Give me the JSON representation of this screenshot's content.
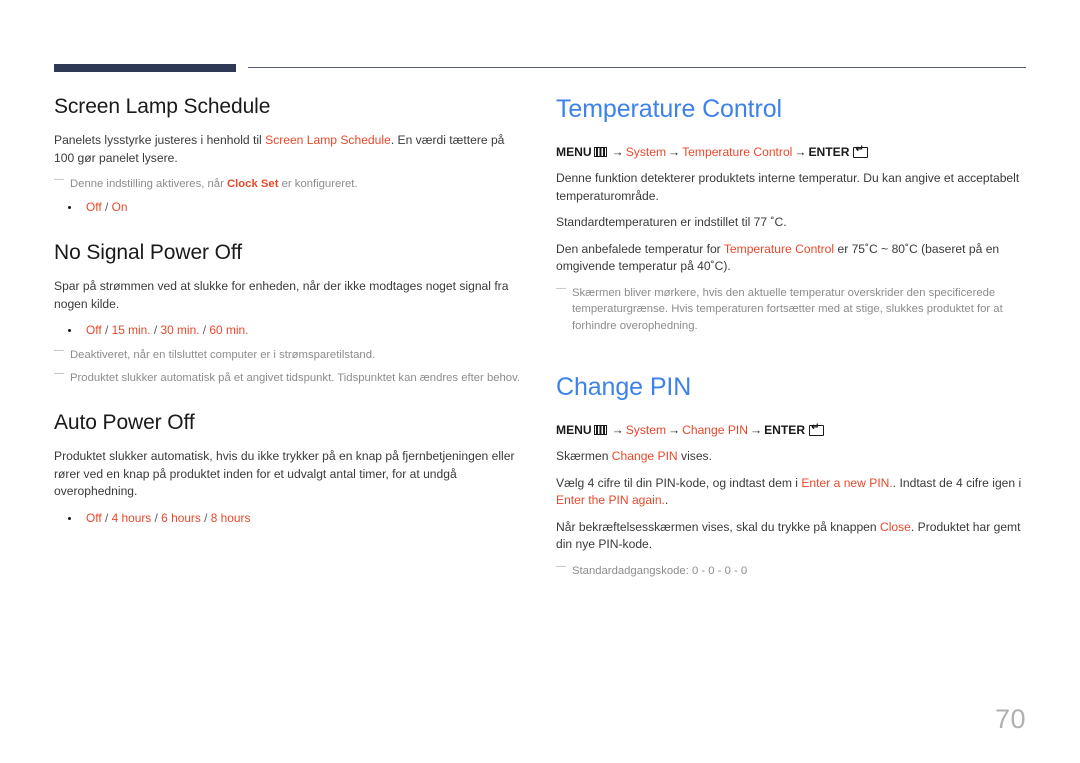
{
  "document": {
    "page_number": "70",
    "accent_color": "#e8482b",
    "heading_blue": "#3d82ea",
    "rule_color": "#2e3a55"
  },
  "left_column": {
    "sections": [
      {
        "title": "Screen Lamp Schedule",
        "paragraph_pre": "Panelets lysstyrke justeres i henhold til ",
        "paragraph_accent": "Screen Lamp Schedule",
        "paragraph_post": ". En værdi tættere på 100 gør panelet lysere.",
        "note_pre": "Denne indstilling aktiveres, når ",
        "note_accent": "Clock Set",
        "note_post": " er konfigureret.",
        "bullet_options": [
          "Off",
          "On"
        ]
      },
      {
        "title": "No Signal Power Off",
        "paragraph": "Spar på strømmen ved at slukke for enheden, når der ikke modtages noget signal fra nogen kilde.",
        "bullet_options": [
          "Off",
          "15 min.",
          "30 min.",
          "60 min."
        ],
        "notes": [
          "Deaktiveret, når en tilsluttet computer er i strømsparetilstand.",
          "Produktet slukker automatisk på et angivet tidspunkt. Tidspunktet kan ændres efter behov."
        ]
      },
      {
        "title": "Auto Power Off",
        "paragraph": "Produktet slukker automatisk, hvis du ikke trykker på en knap på fjernbetjeningen eller rører ved en knap på produktet inden for et udvalgt antal timer, for at undgå overophedning.",
        "bullet_options": [
          "Off",
          "4 hours",
          "6 hours",
          "8 hours"
        ]
      }
    ]
  },
  "right_column": {
    "sections": [
      {
        "title": "Temperature Control",
        "menu_path": {
          "menu_label": "MENU",
          "menu_icon": "menu-grid-icon",
          "items": [
            "System",
            "Temperature Control"
          ],
          "enter_label": "ENTER",
          "enter_icon": "enter-key-icon",
          "arrow": "→"
        },
        "paragraphs": [
          "Denne funktion detekterer produktets interne temperatur. Du kan angive et acceptabelt temperaturområde.",
          "Standardtemperaturen er indstillet til 77 ˚C."
        ],
        "recommended_pre": "Den anbefalede temperatur for ",
        "recommended_accent": "Temperature Control",
        "recommended_post": " er 75˚C ~ 80˚C (baseret på en omgivende temperatur på 40˚C).",
        "notes": [
          "Skærmen bliver mørkere, hvis den aktuelle temperatur overskrider den specificerede temperaturgrænse. Hvis temperaturen fortsætter med at stige, slukkes produktet for at forhindre overophedning."
        ]
      },
      {
        "title": "Change PIN",
        "menu_path": {
          "menu_label": "MENU",
          "menu_icon": "menu-grid-icon",
          "items": [
            "System",
            "Change PIN"
          ],
          "enter_label": "ENTER",
          "enter_icon": "enter-key-icon",
          "arrow": "→"
        },
        "line_screen_pre": "Skærmen ",
        "line_screen_accent": "Change PIN",
        "line_screen_post": " vises.",
        "line_pin_pre": "Vælg 4 cifre til din PIN-kode, og indtast dem i ",
        "line_pin_accent1": "Enter a new PIN.",
        "line_pin_mid": ". Indtast de 4 cifre igen i ",
        "line_pin_accent2": "Enter the PIN again.",
        "line_pin_post": ".",
        "line_confirm_pre": "Når bekræftelsesskærmen vises, skal du trykke på knappen ",
        "line_confirm_accent": "Close",
        "line_confirm_post": ". Produktet har gemt din nye PIN-kode.",
        "notes": [
          "Standardadgangskode: 0 - 0 - 0 - 0"
        ]
      }
    ]
  }
}
